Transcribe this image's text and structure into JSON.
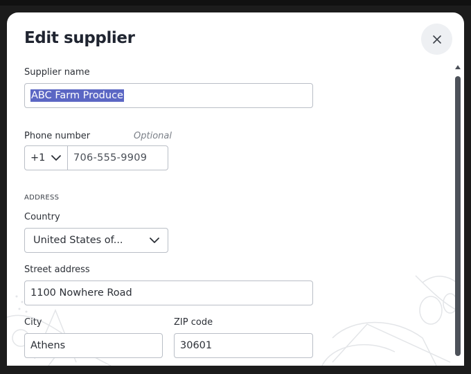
{
  "dialog": {
    "title": "Edit supplier",
    "close_icon": "close-icon"
  },
  "form": {
    "supplier_name": {
      "label": "Supplier name",
      "value": "ABC Farm Produce"
    },
    "phone": {
      "label": "Phone number",
      "optional_text": "Optional",
      "country_code": "+1",
      "value": "706-555-9909"
    },
    "address_heading": "ADDRESS",
    "country": {
      "label": "Country",
      "value": "United States of..."
    },
    "street": {
      "label": "Street address",
      "value": "1100 Nowhere Road"
    },
    "city": {
      "label": "City",
      "value": "Athens"
    },
    "zip": {
      "label": "ZIP code",
      "value": "30601"
    }
  },
  "colors": {
    "selection": "#5b67c4",
    "border": "#b9bec6",
    "scrollbar": "#4d525a"
  }
}
